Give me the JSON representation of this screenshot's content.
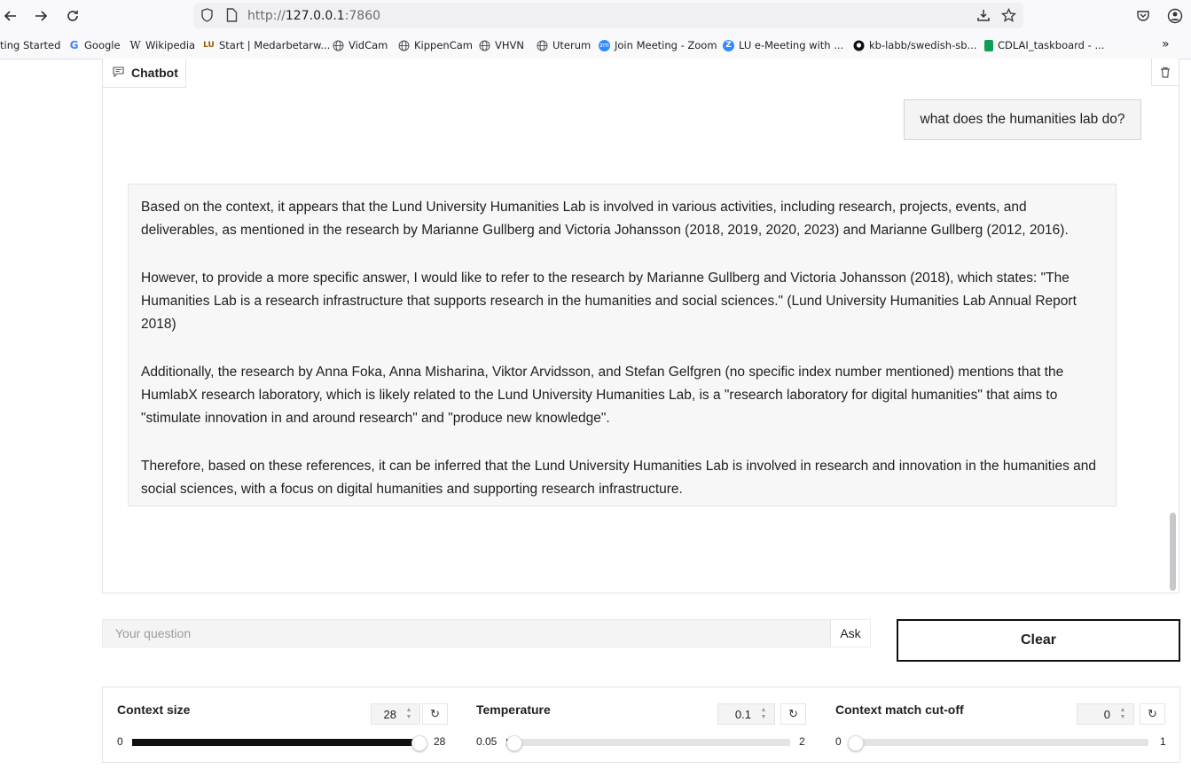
{
  "browser": {
    "url_prefix": "http://",
    "url_host": "127.0.0.1",
    "url_port": ":7860",
    "bookmarks": [
      {
        "label": "ting Started",
        "icon": "firefox-icon",
        "color": "#e66000"
      },
      {
        "label": "Google",
        "icon": "google-icon",
        "color": "#4285f4"
      },
      {
        "label": "Wikipedia",
        "icon": "wikipedia-icon",
        "color": "#000000"
      },
      {
        "label": "Start | Medarbetarw...",
        "icon": "lu-icon",
        "color": "#9a5a00"
      },
      {
        "label": "VidCam",
        "icon": "globe-icon",
        "color": "#555555"
      },
      {
        "label": "KippenCam",
        "icon": "globe-icon",
        "color": "#555555"
      },
      {
        "label": "VHVN",
        "icon": "globe-icon",
        "color": "#555555"
      },
      {
        "label": "Uterum",
        "icon": "globe-icon",
        "color": "#555555"
      },
      {
        "label": "Join Meeting - Zoom",
        "icon": "zoom-icon",
        "color": "#2d8cff"
      },
      {
        "label": "LU e-Meeting with ...",
        "icon": "zoom-icon",
        "color": "#2d8cff"
      },
      {
        "label": "kb-labb/swedish-sb...",
        "icon": "github-icon",
        "color": "#000000"
      },
      {
        "label": "CDLAI_taskboard - ...",
        "icon": "sheet-icon",
        "color": "#0f9d58"
      }
    ]
  },
  "chatbot": {
    "label": "Chatbot",
    "user_message": "what does the humanities lab do?",
    "bot_paragraphs": [
      "Based on the context, it appears that the Lund University Humanities Lab is involved in various activities, including research, projects, events, and deliverables, as mentioned in the research by Marianne Gullberg and Victoria Johansson (2018, 2019, 2020, 2023) and Marianne Gullberg (2012, 2016).",
      "However, to provide a more specific answer, I would like to refer to the research by Marianne Gullberg and Victoria Johansson (2018), which states: \"The Humanities Lab is a research infrastructure that supports research in the humanities and social sciences.\" (Lund University Humanities Lab Annual Report 2018)",
      "Additionally, the research by Anna Foka, Anna Misharina, Viktor Arvidsson, and Stefan Gelfgren (no specific index number mentioned) mentions that the HumlabX research laboratory, which is likely related to the Lund University Humanities Lab, is a \"research laboratory for digital humanities\" that aims to \"stimulate innovation in and around research\" and \"produce new knowledge\".",
      "Therefore, based on these references, it can be inferred that the Lund University Humanities Lab is involved in research and innovation in the humanities and social sciences, with a focus on digital humanities and supporting research infrastructure."
    ]
  },
  "input": {
    "placeholder": "Your question",
    "value": "",
    "ask_label": "Ask",
    "clear_label": "Clear"
  },
  "sliders": [
    {
      "label": "Context size",
      "value": "28",
      "min": "0",
      "max": "28",
      "fraction": 1.0
    },
    {
      "label": "Temperature",
      "value": "0.1",
      "min": "0.05",
      "max": "2",
      "fraction": 0.0256
    },
    {
      "label": "Context match cut-off",
      "value": "0",
      "min": "0",
      "max": "1",
      "fraction": 0.0
    }
  ]
}
